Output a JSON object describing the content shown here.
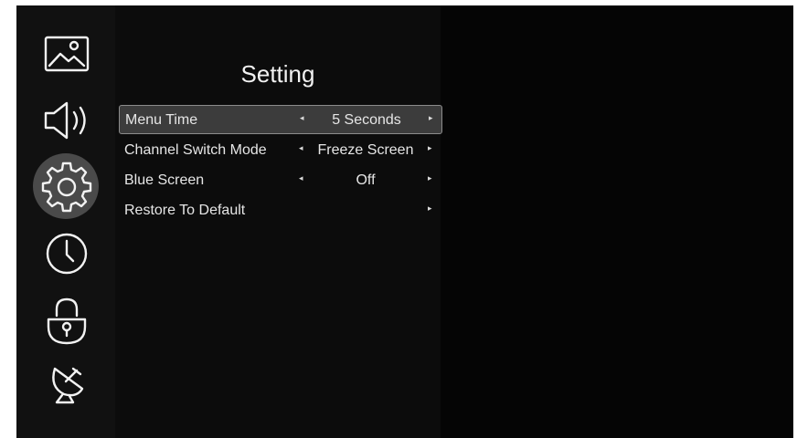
{
  "sidebar": {
    "items": [
      {
        "icon": "picture-icon",
        "active": false
      },
      {
        "icon": "speaker-icon",
        "active": false
      },
      {
        "icon": "gear-icon",
        "active": true
      },
      {
        "icon": "clock-icon",
        "active": false
      },
      {
        "icon": "lock-icon",
        "active": false
      },
      {
        "icon": "satellite-dish-icon",
        "active": false
      }
    ]
  },
  "panel": {
    "title": "Setting",
    "rows": [
      {
        "label": "Menu Time",
        "value": "5 Seconds",
        "selected": true
      },
      {
        "label": "Channel Switch Mode",
        "value": "Freeze Screen",
        "selected": false
      },
      {
        "label": "Blue Screen",
        "value": "Off",
        "selected": false
      },
      {
        "label": "Restore To Default",
        "value": "",
        "selected": false
      }
    ],
    "arrow_left": "◂",
    "arrow_right": "▸"
  }
}
